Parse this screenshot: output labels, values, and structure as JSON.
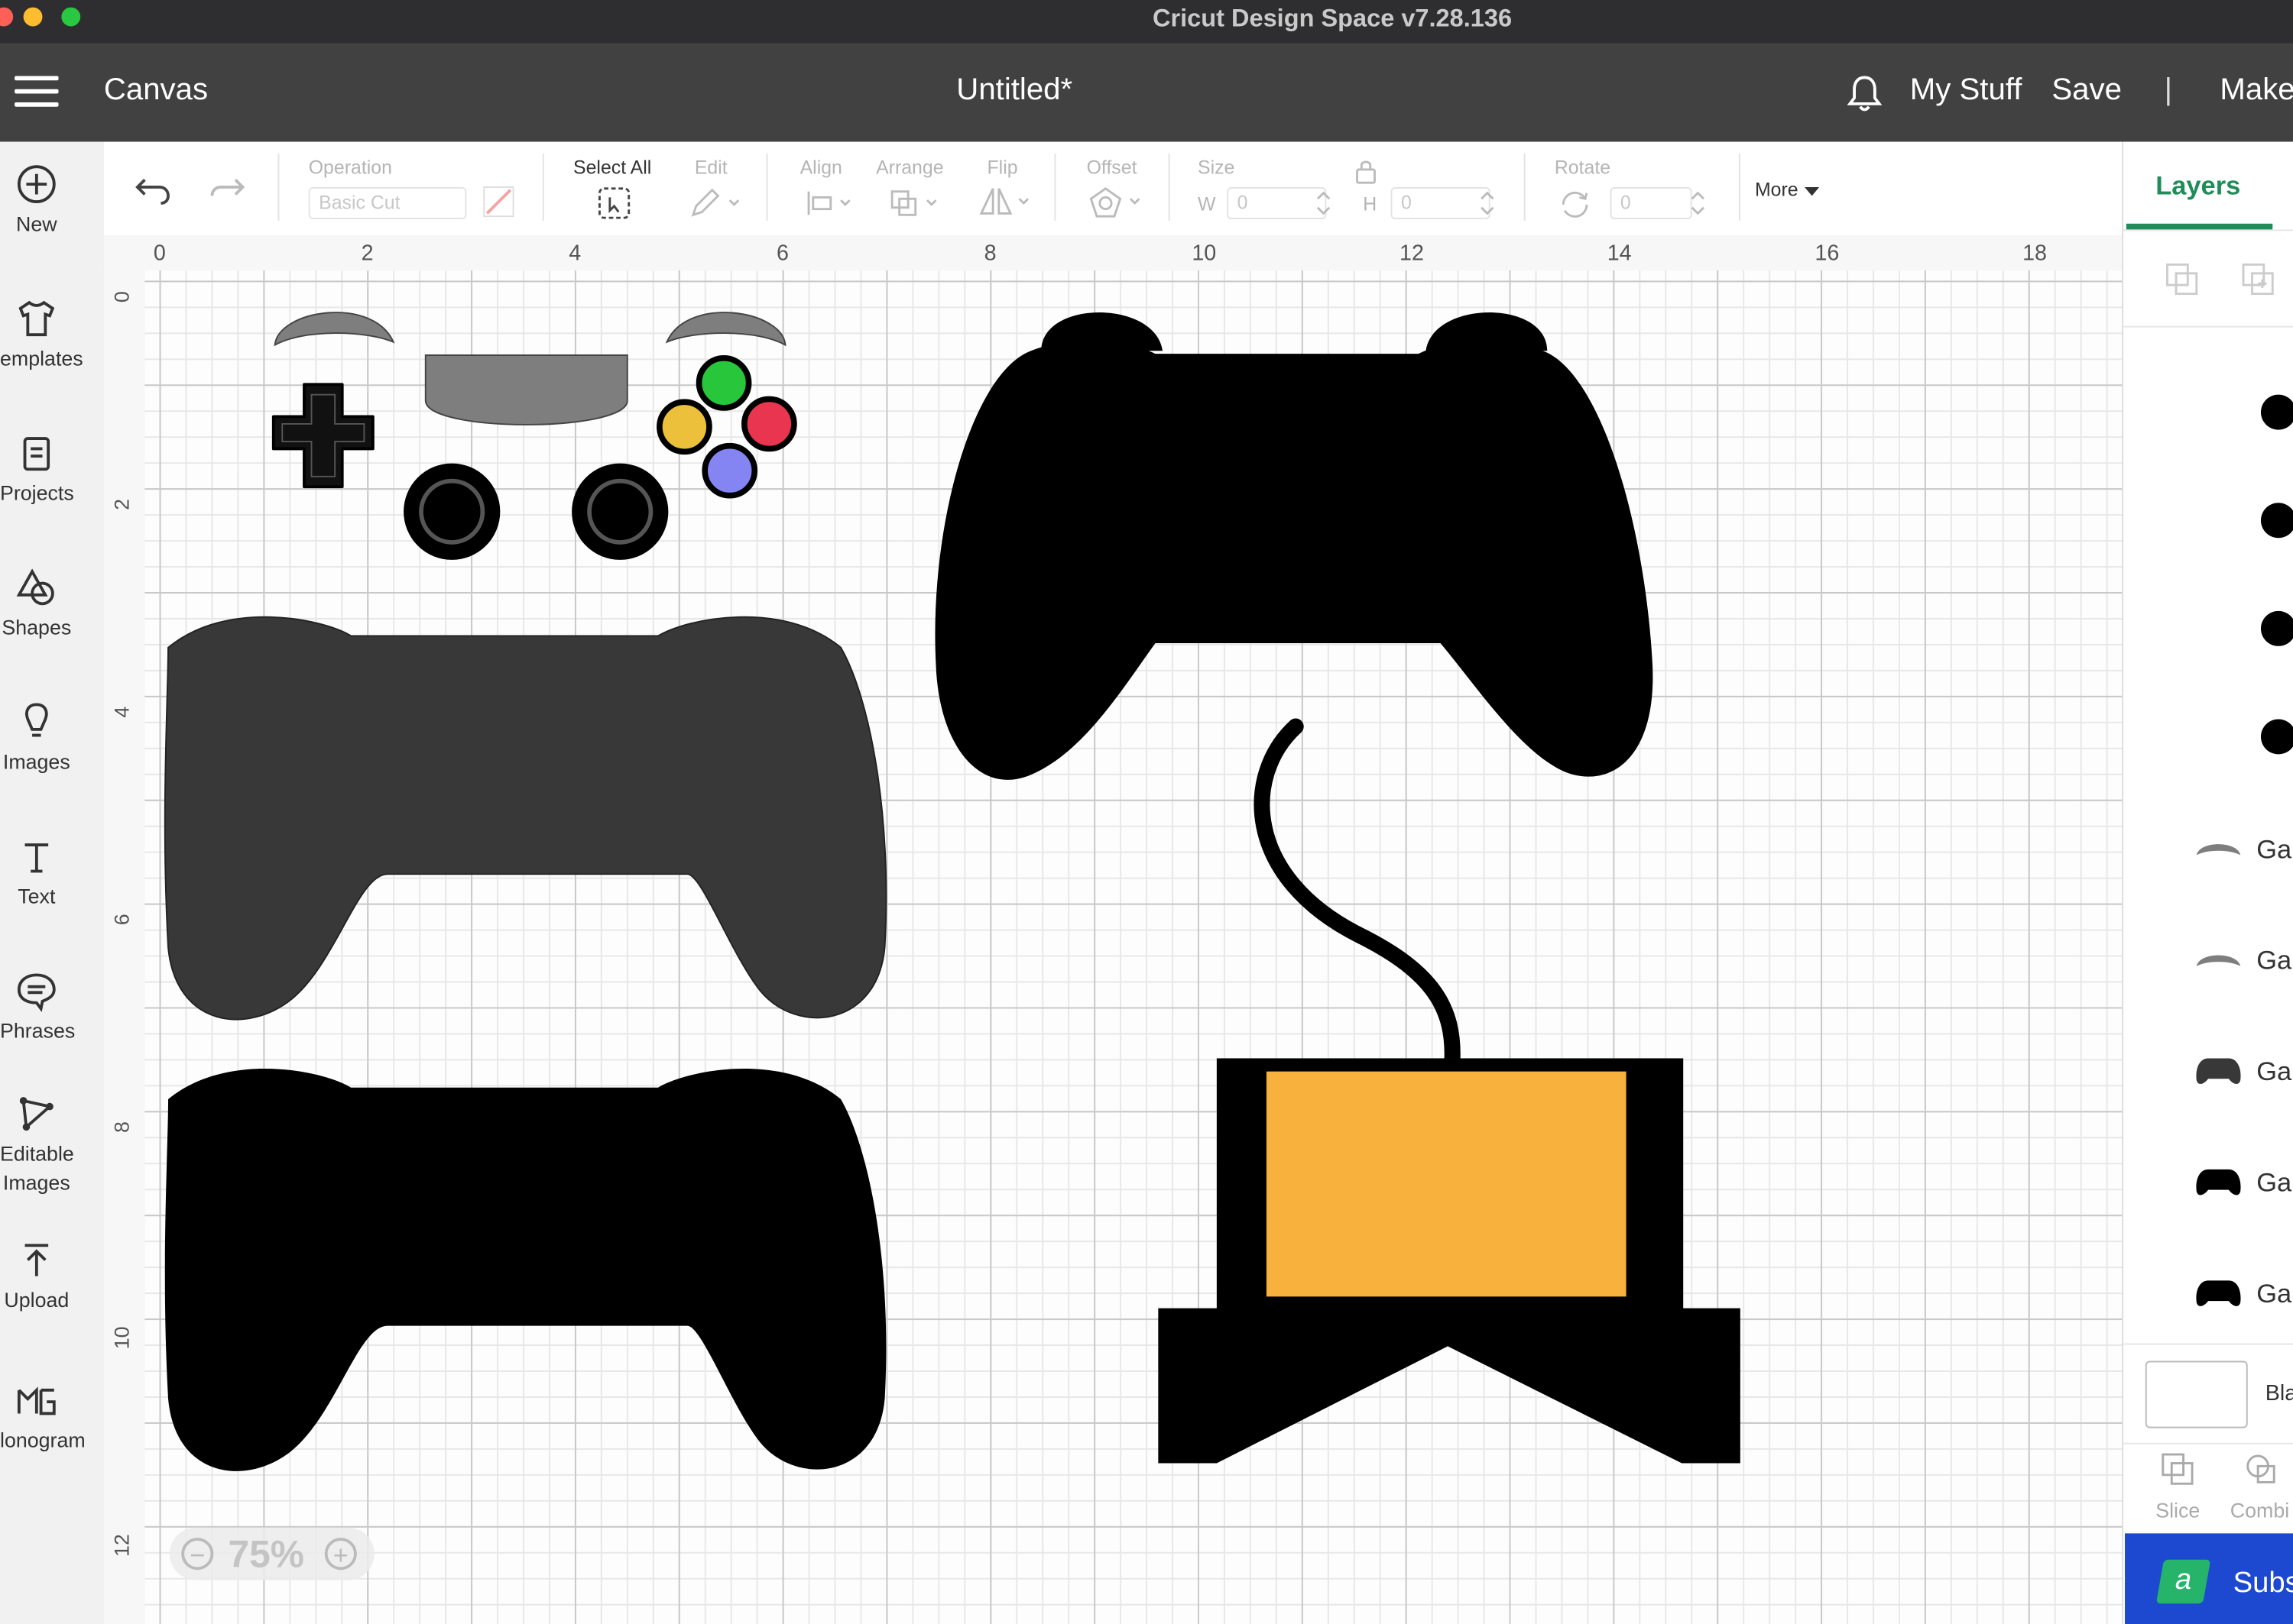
{
  "window": {
    "title": "Cricut Design Space  v7.28.136"
  },
  "header": {
    "menu_icon": "hamburger-icon",
    "section": "Canvas",
    "document_title": "Untitled*",
    "notification_icon": "bell-icon",
    "my_stuff": "My Stuff",
    "save": "Save",
    "separator": "|",
    "make": "Make"
  },
  "sidebar": {
    "items": [
      {
        "label": "New",
        "icon": "plus-circle-icon"
      },
      {
        "label": "emplates",
        "icon": "shirt-icon"
      },
      {
        "label": "Projects",
        "icon": "clipboard-icon"
      },
      {
        "label": "Shapes",
        "icon": "shapes-icon"
      },
      {
        "label": "Images",
        "icon": "lightbulb-icon"
      },
      {
        "label": "Text",
        "icon": "text-icon"
      },
      {
        "label": "Phrases",
        "icon": "speech-bubble-icon"
      },
      {
        "label": "Editable",
        "label2": "Images",
        "icon": "editable-images-icon"
      },
      {
        "label": "Upload",
        "icon": "upload-icon"
      },
      {
        "label": "lonogram",
        "icon": "monogram-icon"
      }
    ]
  },
  "toolbar": {
    "operation_label": "Operation",
    "operation_value": "Basic Cut",
    "select_all": "Select All",
    "edit": "Edit",
    "align": "Align",
    "arrange": "Arrange",
    "flip": "Flip",
    "offset": "Offset",
    "size": "Size",
    "w_label": "W",
    "w_value": "0",
    "h_label": "H",
    "h_value": "0",
    "rotate": "Rotate",
    "rotate_value": "0",
    "more": "More"
  },
  "ruler": {
    "top": [
      "0",
      "2",
      "4",
      "6",
      "8",
      "10",
      "12",
      "14",
      "16",
      "18"
    ],
    "left": [
      "0",
      "2",
      "4",
      "6",
      "8",
      "10",
      "12"
    ]
  },
  "canvas": {
    "zoom": "75%",
    "colors": {
      "controller_gray": "#383838",
      "controller_black": "#000000",
      "bumper_gray": "#7e7e7e",
      "button_green": "#27c63b",
      "button_red": "#ea3550",
      "button_yellow": "#ecc03a",
      "button_blue": "#8484f2",
      "console_screen": "#f8b13c"
    }
  },
  "layers_panel": {
    "tab": "Layers",
    "items": [
      "Ga",
      "Ga",
      "Ga",
      "Ga",
      "Ga"
    ],
    "blank_label": "Bla",
    "slice": "Slice",
    "combine": "Combi",
    "subscribe": "Subs",
    "subscribe_badge": "a",
    "accent": "#1f8c5a",
    "banner_color": "#1d49d1"
  }
}
